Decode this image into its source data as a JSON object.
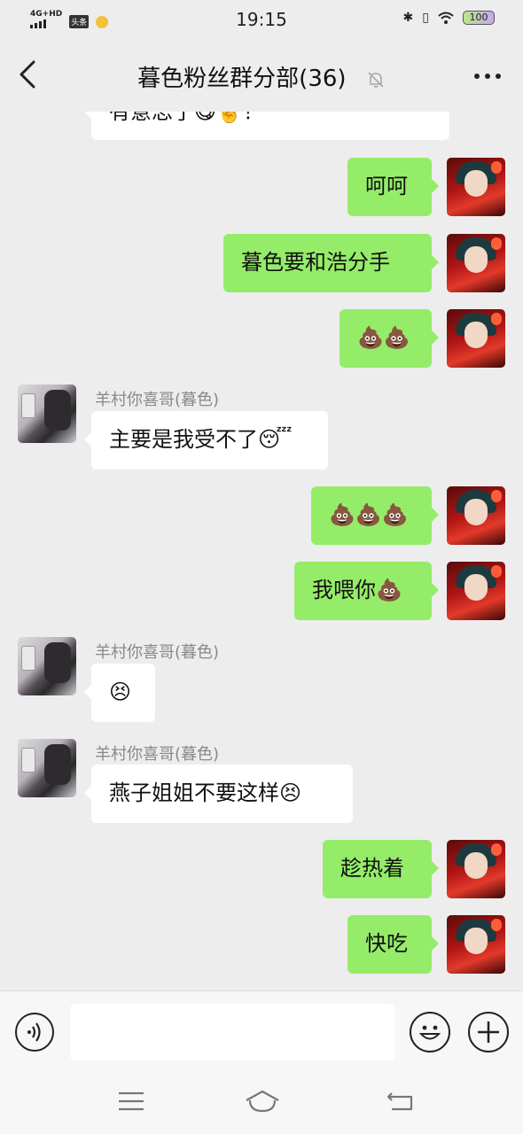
{
  "status_bar": {
    "network": "4G+HD",
    "app_badge": "头条",
    "time": "19:15",
    "battery": "100"
  },
  "header": {
    "title": "暮色粉丝群分部(36)"
  },
  "messages": [
    {
      "side": "left",
      "text": "有意思了😋✌️！"
    },
    {
      "side": "right",
      "text": "呵呵"
    },
    {
      "side": "right",
      "text": "暮色要和浩分手"
    },
    {
      "side": "right",
      "text": "💩💩"
    },
    {
      "side": "left",
      "sender": "羊村你喜哥(暮色)",
      "text": "主要是我受不了😴"
    },
    {
      "side": "right",
      "text": "💩💩💩"
    },
    {
      "side": "right",
      "text": "我喂你💩"
    },
    {
      "side": "left",
      "sender": "羊村你喜哥(暮色)",
      "text": "😣"
    },
    {
      "side": "left",
      "sender": "羊村你喜哥(暮色)",
      "text": "燕子姐姐不要这样😣"
    },
    {
      "side": "right",
      "text": "趁热着"
    },
    {
      "side": "right",
      "text": "快吃"
    }
  ],
  "icons": {
    "back": "chevron-left-icon",
    "mute": "bell-off-icon",
    "more": "more-dots-icon",
    "voice": "voice-icon",
    "emoji": "emoji-icon",
    "plus": "plus-icon",
    "nav_menu": "menu-icon",
    "nav_home": "home-icon",
    "nav_back": "back-icon"
  },
  "colors": {
    "own_bubble": "#95ec69",
    "other_bubble": "#ffffff",
    "background": "#ededed"
  }
}
